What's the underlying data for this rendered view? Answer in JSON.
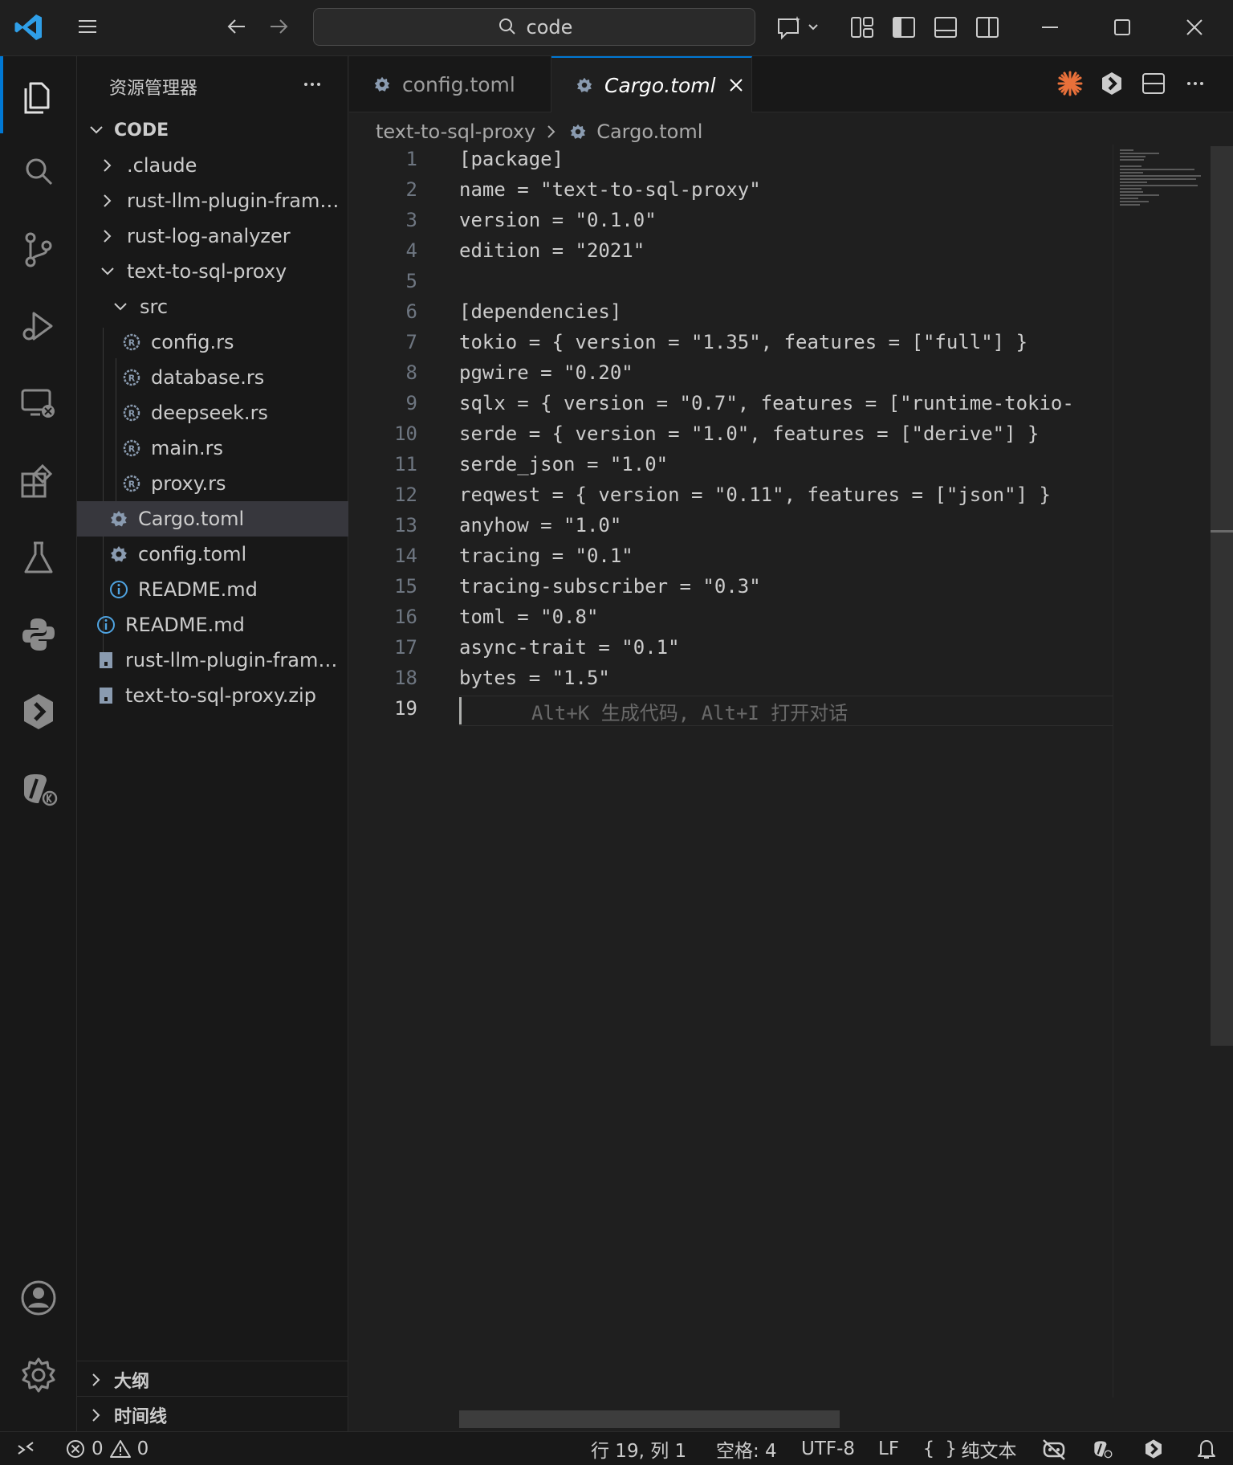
{
  "titlebar": {
    "search_text": "code"
  },
  "sidebar": {
    "title": "资源管理器",
    "root_label": "CODE",
    "items": [
      {
        "label": ".claude"
      },
      {
        "label": "rust-llm-plugin-frame..."
      },
      {
        "label": "rust-log-analyzer"
      },
      {
        "label": "text-to-sql-proxy"
      },
      {
        "label": "src"
      },
      {
        "label": "config.rs"
      },
      {
        "label": "database.rs"
      },
      {
        "label": "deepseek.rs"
      },
      {
        "label": "main.rs"
      },
      {
        "label": "proxy.rs"
      },
      {
        "label": "Cargo.toml"
      },
      {
        "label": "config.toml"
      },
      {
        "label": "README.md"
      },
      {
        "label": "README.md"
      },
      {
        "label": "rust-llm-plugin-frame..."
      },
      {
        "label": "text-to-sql-proxy.zip"
      }
    ],
    "outline_label": "大纲",
    "timeline_label": "时间线"
  },
  "tabs": [
    {
      "label": "config.toml"
    },
    {
      "label": "Cargo.toml"
    }
  ],
  "breadcrumb": {
    "folder": "text-to-sql-proxy",
    "file": "Cargo.toml"
  },
  "editor": {
    "lines": [
      {
        "n": "1",
        "text": "[package]"
      },
      {
        "n": "2",
        "text": "name = \"text-to-sql-proxy\""
      },
      {
        "n": "3",
        "text": "version = \"0.1.0\""
      },
      {
        "n": "4",
        "text": "edition = \"2021\""
      },
      {
        "n": "5",
        "text": ""
      },
      {
        "n": "6",
        "text": "[dependencies]"
      },
      {
        "n": "7",
        "text": "tokio = { version = \"1.35\", features = [\"full\"] }"
      },
      {
        "n": "8",
        "text": "pgwire = \"0.20\""
      },
      {
        "n": "9",
        "text": "sqlx = { version = \"0.7\", features = [\"runtime-tokio-"
      },
      {
        "n": "10",
        "text": "serde = { version = \"1.0\", features = [\"derive\"] }"
      },
      {
        "n": "11",
        "text": "serde_json = \"1.0\""
      },
      {
        "n": "12",
        "text": "reqwest = { version = \"0.11\", features = [\"json\"] }"
      },
      {
        "n": "13",
        "text": "anyhow = \"1.0\""
      },
      {
        "n": "14",
        "text": "tracing = \"0.1\""
      },
      {
        "n": "15",
        "text": "tracing-subscriber = \"0.3\""
      },
      {
        "n": "16",
        "text": "toml = \"0.8\""
      },
      {
        "n": "17",
        "text": "async-trait = \"0.1\""
      },
      {
        "n": "18",
        "text": "bytes = \"1.5\""
      },
      {
        "n": "19",
        "text": ""
      }
    ],
    "ghost_hint": "Alt+K 生成代码, Alt+I 打开对话"
  },
  "statusbar": {
    "errors": "0",
    "warnings": "0",
    "position": "行 19, 列 1",
    "spaces": "空格: 4",
    "encoding": "UTF-8",
    "eol": "LF",
    "language": "纯文本"
  },
  "colors": {
    "accent": "#0078d4",
    "rust_icon": "#8a9bb0",
    "gear_icon": "#8a9bb0",
    "info_icon": "#4fa3e0",
    "claude_star": "#e8703a"
  }
}
